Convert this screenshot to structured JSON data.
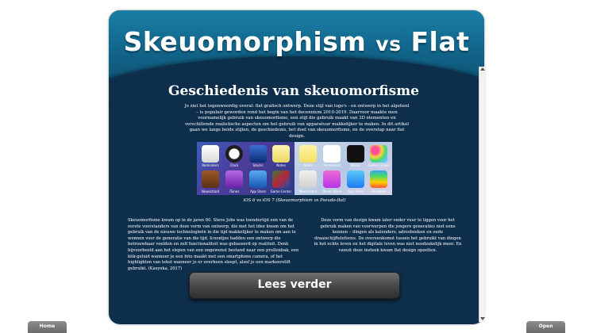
{
  "header": {
    "title_main": "Skeuomorphism",
    "title_vs": "vs",
    "title_end": "Flat"
  },
  "article": {
    "title": "Geschiedenis van skeuomorfisme",
    "intro": "Je ziet het tegenwoordig overal: flat grafisch ontwerp. Deze stijl van logo's - en ontwerp in het algeheel – is populair geworden rond het begin van het decennium 2010-2019. Daarvoor maakte men voornamelijk gebruik van skeuomorfisme, een stijl die gebruik maakt van 3D elementen en verschillende realistische aspecten om het gebruik van apparatuur makkelijker te maken. In dit artikel gaan we langs beide stijlen, de geschiedenis, het doel van skeuomorfisme, en de overstap naar flat design.",
    "caption": "iOS 6 vs iOS 7 (Skeuomorphism vs Pseudo-flat)",
    "col_left": "Skeuomorfisme kwam op in de jaren 80. Steve Jobs was toendertijd een van de eerste voorstanders van deze vorm van ontwerp, die met het idee kwam om het gebruik van de nieuwe technologieën in die tijd makkelijker te maken om aan te wennen voor de generatie van die tijd. Icoontjes hadden een ontwerp die betrouwbaar voelden en zelf functionaliteit was gebaseerd op realiteit. Denk bijvoorbeeld aan het slepen van een ongewenst bestand naar een prullenbak, een klik-geluid wanneer je een foto maakt met een smartphone camera, of het highlighten van tekst wanneer je er overheen sleept, alsof je een markeerstift gebruikt. (Kasyoka, 2017)",
    "col_right": "Deze vorm van design kwam later onder vuur te liggen voor het gebruik maken van voorwerpen die jongere generaties niet eens kennen – dingen als kalenders, adresboeken en oude draaischijftelefoons. De overeenkomst tussen het gebruikt van dingen in het echte leven en het digitale leven was niet noodzakelijk meer. En vanuit deze insteek kwam flat design opzetten.",
    "read_more": "Lees verder"
  },
  "figure": {
    "left_apps": [
      "Reminders",
      "Clock",
      "Stocks",
      "Notes",
      "Newsstand",
      "iTunes",
      "App Store",
      "Game Center"
    ],
    "right_apps": [
      "Notes",
      "Reminders",
      "Stocks",
      "Game Center",
      "Newsstand",
      "iTunes Store",
      "App Store",
      "Passbook"
    ]
  },
  "nav": {
    "home": "Home",
    "open": "Open"
  },
  "colors": {
    "card_bg": "#0e2f4c",
    "header_bg": "#1a7fa6",
    "button_bg": "#4a4a4a"
  }
}
